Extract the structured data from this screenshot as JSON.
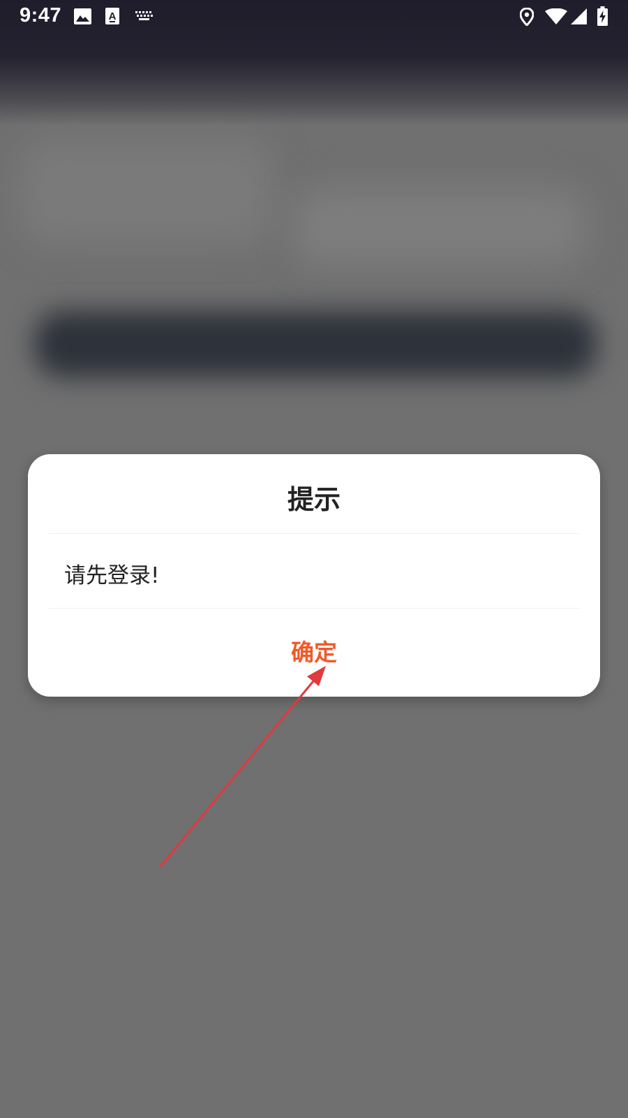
{
  "status_bar": {
    "time": "9:47",
    "icons_left": [
      "image-icon",
      "text-a-icon",
      "keyboard-icon"
    ],
    "icons_right": [
      "location-icon",
      "wifi-icon",
      "signal-icon",
      "battery-charging-icon"
    ]
  },
  "dialog": {
    "title": "提示",
    "message": "请先登录!",
    "confirm_label": "确定"
  },
  "colors": {
    "accent": "#f05a28",
    "annotation_arrow": "#e0393e",
    "dialog_background": "#ffffff",
    "overlay": "#707070"
  }
}
